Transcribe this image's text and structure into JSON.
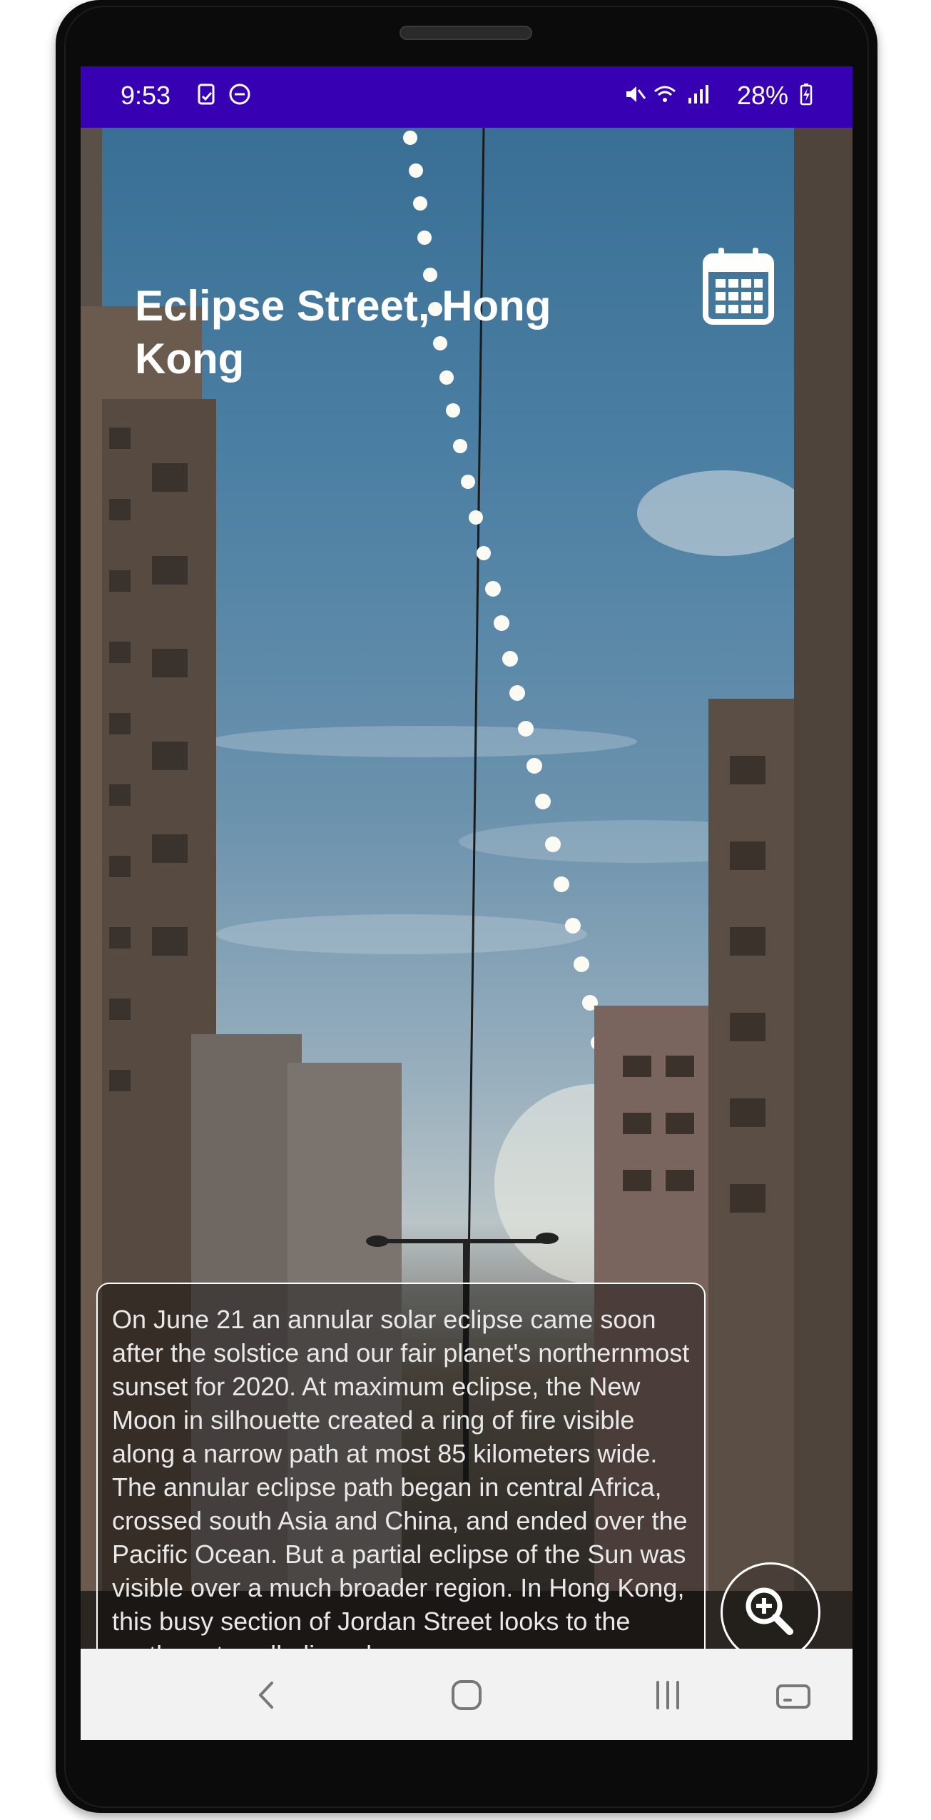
{
  "status_bar": {
    "time": "9:53",
    "battery": "28%",
    "icons": [
      "sim-card-icon",
      "do-not-disturb-icon",
      "mute-icon",
      "wifi-icon",
      "signal-icon",
      "battery-charging-icon"
    ]
  },
  "header": {
    "title": "Eclipse Street, Hong Kong",
    "calendar_icon": "calendar-icon"
  },
  "description": {
    "text": "On June 21 an annular solar eclipse came soon after the solstice and our fair planet's northernmost sunset for 2020. At maximum eclipse, the New Moon in silhouette created a ring of fire visible along a narrow path at most 85 kilometers wide. The annular eclipse path began in central Africa, crossed south Asia and China, and ended over the Pacific Ocean. But a partial eclipse of the Sun was visible over a much broader region. In Hong Kong, this busy section of Jordan Street looks to the northwest, well aligned"
  },
  "zoom_button": {
    "icon": "zoom-in-icon"
  },
  "nav_bar": {
    "buttons": [
      "back-icon",
      "home-icon",
      "recents-icon",
      "keyboard-toggle-icon"
    ]
  },
  "colors": {
    "status_bar": "#3700b3",
    "nav_bar": "#f2f2f2",
    "text_light": "#ffffff"
  }
}
